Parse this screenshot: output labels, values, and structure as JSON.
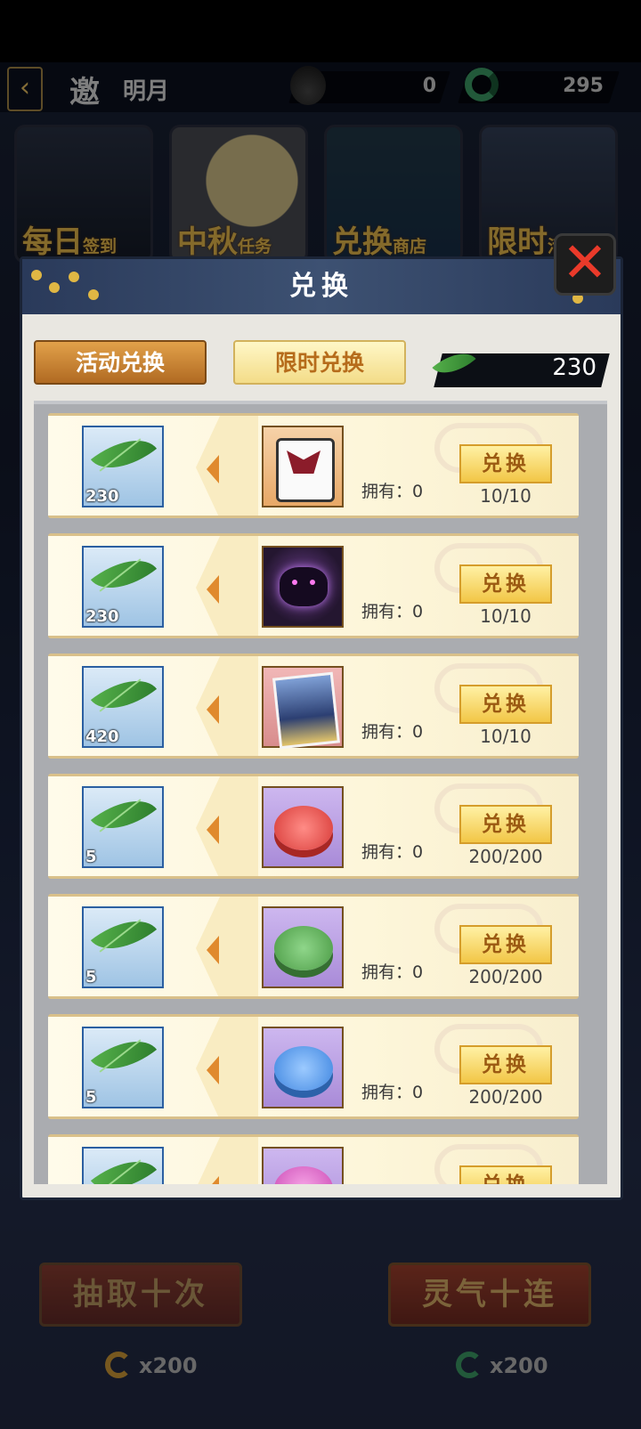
{
  "header": {
    "back_icon": "chevron-left-icon",
    "title_main": "邀",
    "title_sub": "明月",
    "currency_a": {
      "icon": "pouch-icon",
      "value": "0"
    },
    "currency_b": {
      "icon": "jade-ring-icon",
      "value": "295"
    }
  },
  "events": [
    {
      "label_big": "每日",
      "label_small": "签到"
    },
    {
      "label_big": "中秋",
      "label_small": "任务"
    },
    {
      "label_big": "兑换",
      "label_small": "商店"
    },
    {
      "label_big": "限时",
      "label_small": "活动"
    }
  ],
  "panel": {
    "title": "兑换",
    "close_icon": "close-icon",
    "tabs": [
      {
        "label": "活动兑换",
        "active": true
      },
      {
        "label": "限时兑换",
        "active": false
      }
    ],
    "balance": {
      "icon": "leaf-icon",
      "value": "230"
    }
  },
  "exchange": {
    "owned_prefix": "拥有：",
    "button_label": "兑换",
    "items": [
      {
        "cost": "230",
        "item_icon": "gift-bag-icon",
        "owned": "0",
        "limit": "10/10"
      },
      {
        "cost": "230",
        "item_icon": "dark-beast-icon",
        "owned": "0",
        "limit": "10/10"
      },
      {
        "cost": "420",
        "item_icon": "scenery-card-icon",
        "owned": "0",
        "limit": "10/10"
      },
      {
        "cost": "5",
        "item_icon": "red-mooncake-icon",
        "owned": "0",
        "limit": "200/200"
      },
      {
        "cost": "5",
        "item_icon": "green-mooncake-icon",
        "owned": "0",
        "limit": "200/200"
      },
      {
        "cost": "5",
        "item_icon": "blue-mooncake-icon",
        "owned": "0",
        "limit": "200/200"
      },
      {
        "cost": "",
        "item_icon": "pink-mooncake-icon",
        "owned": "",
        "limit": ""
      }
    ]
  },
  "bottom": {
    "draw_ten_label": "抽取十次",
    "spirit_ten_label": "灵气十连",
    "draw_ten_cost": "x200",
    "spirit_ten_cost": "x200"
  },
  "colors": {
    "accent": "#f2c646",
    "panel_header": "#2a3a5a",
    "tab_active": "#c9853a"
  }
}
